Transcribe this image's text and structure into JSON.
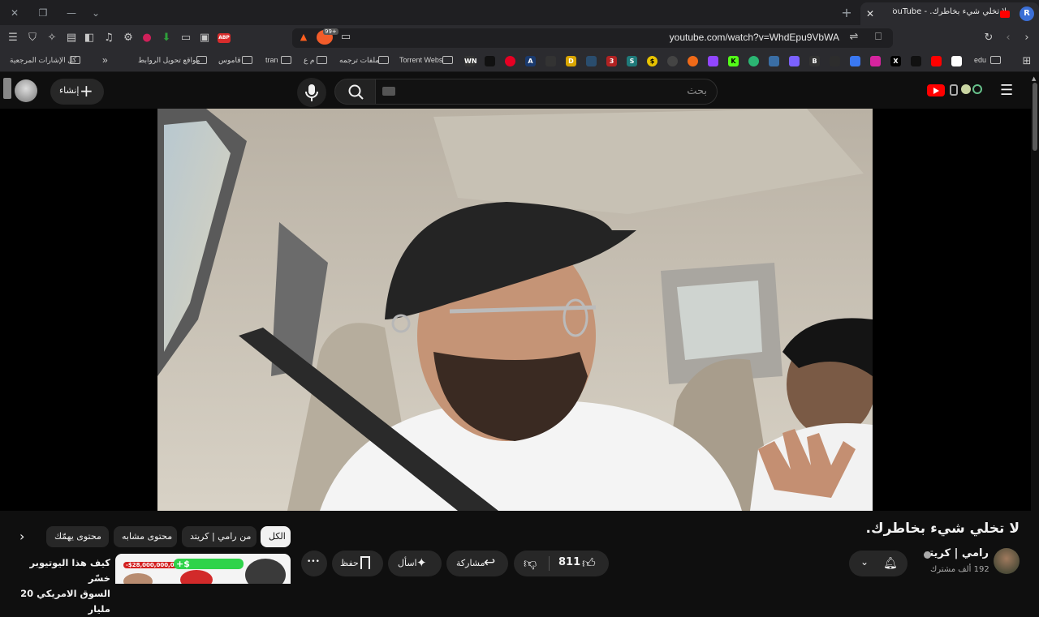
{
  "browser": {
    "tab_title": "لا تخلي شيء بخاطرك. - YouTube",
    "url": "youtube.com/watch?v=WhdEpu9VbWA",
    "badge_count": "99+",
    "abp_label": "ABP",
    "profile_letter": "R"
  },
  "bookmarks": {
    "all_label": "كل الإشارات المرجعية",
    "more_label": "»",
    "items": [
      {
        "label": "مواقع تحويل الروابط"
      },
      {
        "label": "قاموس"
      },
      {
        "label": "tran"
      },
      {
        "label": "م ع"
      },
      {
        "label": "ملفات ترجمه"
      },
      {
        "label": "Torrent Webs"
      },
      {
        "label": "edu"
      }
    ],
    "favicons": [
      "WN",
      "A",
      "D",
      "3",
      "S",
      "$",
      "K",
      "B",
      "X"
    ]
  },
  "youtube": {
    "search_placeholder": "بحث",
    "create_label": "إنشاء",
    "video_title": "لا تخلي شيء بخاطرك.",
    "channel_name": "رامي | كريتد",
    "subscribers": "192 ألف مشترك",
    "likes": "811",
    "share_label": "مشاركة",
    "ask_label": "اسأل",
    "save_label": "حفظ",
    "more_label": "•••",
    "chips": [
      {
        "label": "الكل",
        "active": true
      },
      {
        "label": "من رامي | كريتد",
        "active": false
      },
      {
        "label": "محتوى مشابه",
        "active": false
      },
      {
        "label": "محتوى يهمّك",
        "active": false
      }
    ],
    "recommended": {
      "title_line1": "كيف هذا اليوتيوبر خسّر",
      "title_line2": "السوق الامريكي 20 مليار",
      "thumb_red_text": "-$28,000,000,000",
      "thumb_green_text": "+$"
    }
  }
}
